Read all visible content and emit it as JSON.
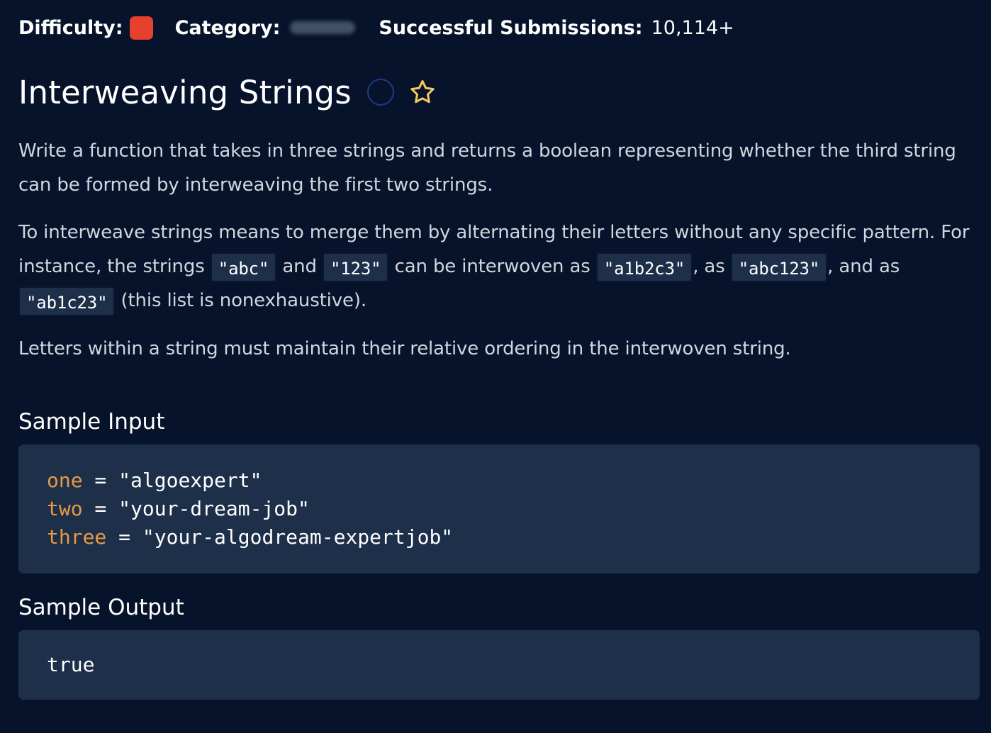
{
  "meta": {
    "difficulty_label": "Difficulty:",
    "difficulty_color": "#e7402e",
    "category_label": "Category:",
    "submissions_label": "Successful Submissions:",
    "submissions_value": "10,114+"
  },
  "problem": {
    "title": "Interweaving Strings",
    "status_icon": "empty-circle-icon",
    "favorite_icon": "star-outline-icon",
    "paragraphs": {
      "p1": "Write a function that takes in three strings and returns a boolean representing whether the third string can be formed by interweaving the first two strings.",
      "p2": {
        "part1": "To interweave strings means to merge them by alternating their letters without any specific pattern. For instance, the strings ",
        "code1": "\"abc\"",
        "part2": " and ",
        "code2": "\"123\"",
        "part3": " can be interwoven as ",
        "code3": "\"a1b2c3\"",
        "part4": ", as ",
        "code4": "\"abc123\"",
        "part5": ", and as ",
        "code5": "\"ab1c23\"",
        "part6": " (this list is nonexhaustive)."
      },
      "p3": "Letters within a string must maintain their relative ordering in the interwoven string."
    }
  },
  "sample_input": {
    "title": "Sample Input",
    "lines": [
      {
        "key": "one",
        "rest": " = \"algoexpert\""
      },
      {
        "key": "two",
        "rest": " = \"your-dream-job\""
      },
      {
        "key": "three",
        "rest": " = \"your-algodream-expertjob\""
      }
    ]
  },
  "sample_output": {
    "title": "Sample Output",
    "value": "true"
  },
  "colors": {
    "background": "#06132a",
    "code_background": "#1e2f4a",
    "accent_orange": "#e79a43",
    "favorite_star": "#f6c85f",
    "status_circle": "#1e3a8a"
  }
}
